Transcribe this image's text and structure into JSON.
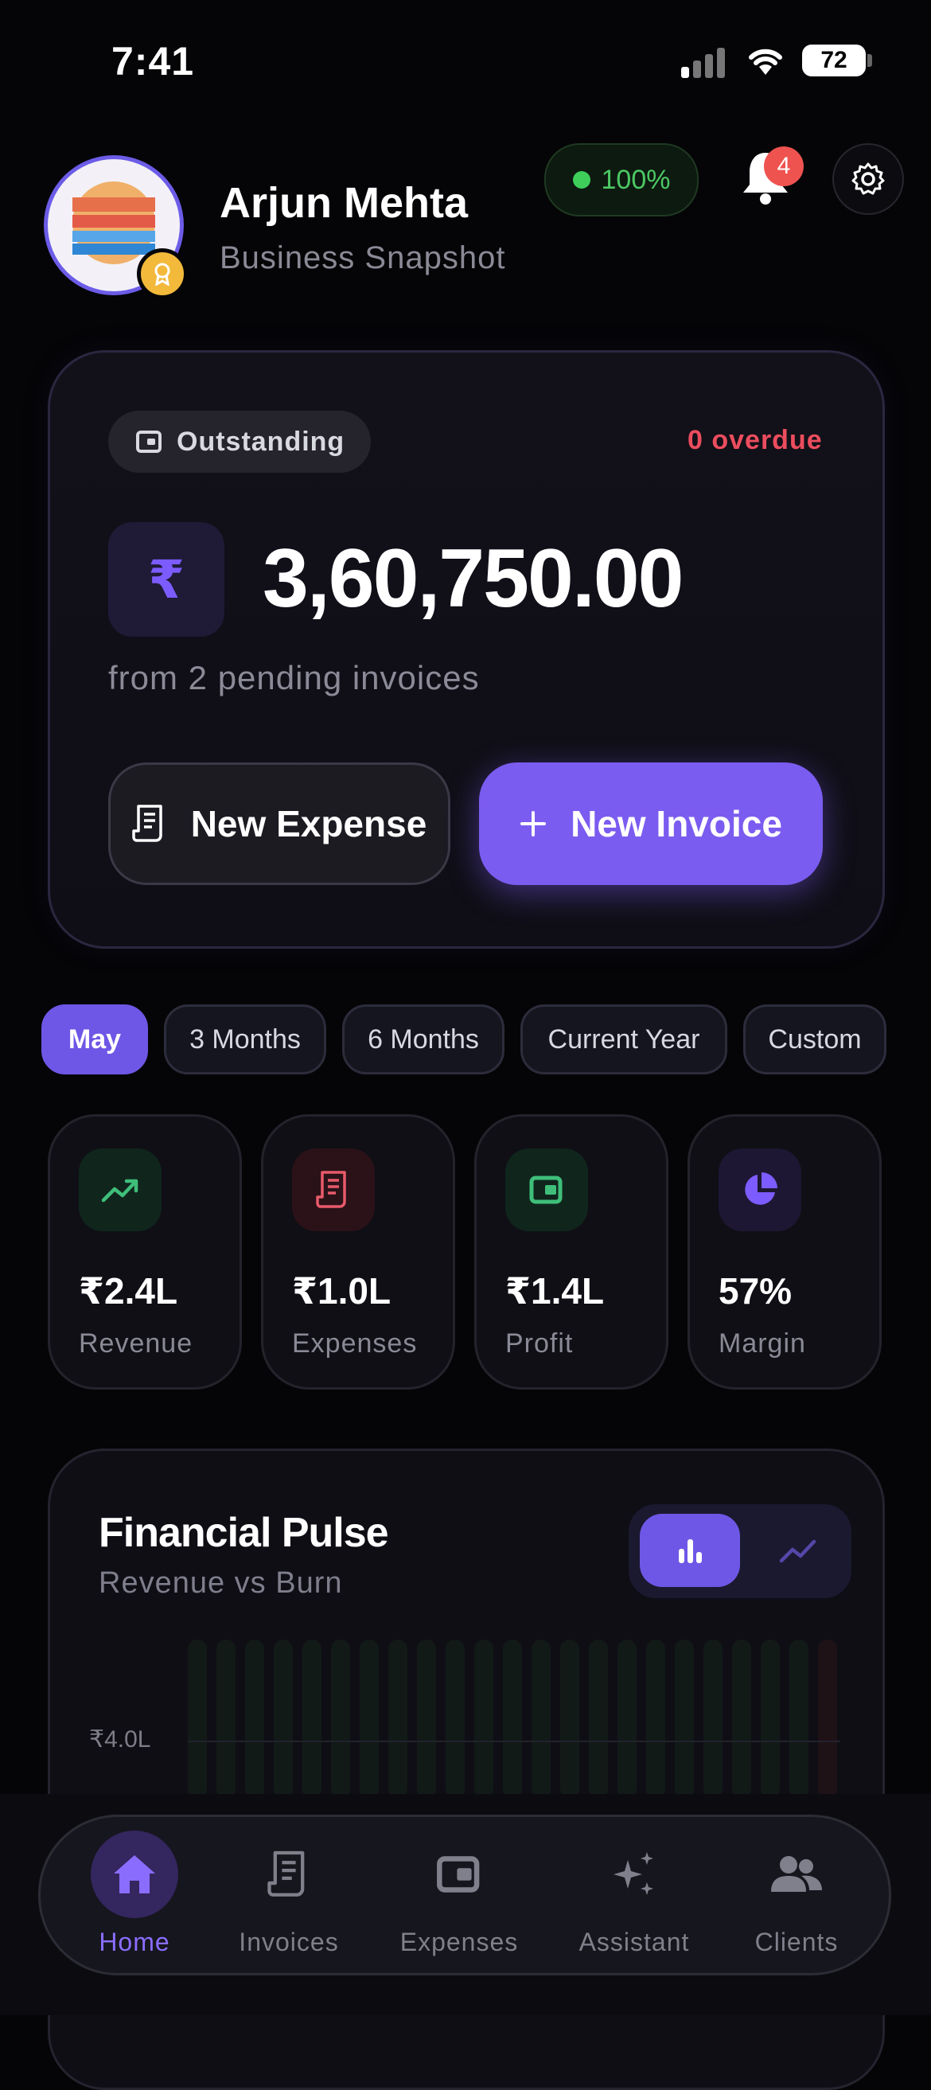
{
  "status_bar": {
    "time": "7:41",
    "battery": "72"
  },
  "header": {
    "name": "Arjun Mehta",
    "subtitle": "Business Snapshot",
    "health": "100%",
    "notifications_count": "4"
  },
  "outstanding": {
    "label": "Outstanding",
    "overdue": "0 overdue",
    "currency_symbol": "₹",
    "amount": "3,60,750.00",
    "pending_text": "from 2 pending invoices",
    "new_expense": "New Expense",
    "new_invoice": "New Invoice"
  },
  "periods": [
    {
      "label": "May",
      "active": true
    },
    {
      "label": "3 Months",
      "active": false
    },
    {
      "label": "6 Months",
      "active": false
    },
    {
      "label": "Current Year",
      "active": false
    },
    {
      "label": "Custom",
      "active": false
    }
  ],
  "stats": [
    {
      "value": "₹2.4L",
      "label": "Revenue",
      "icon": "trending-up-icon",
      "color": "#3fbf7a"
    },
    {
      "value": "₹1.0L",
      "label": "Expenses",
      "icon": "receipt-icon",
      "color": "#e85a6a"
    },
    {
      "value": "₹1.4L",
      "label": "Profit",
      "icon": "wallet-icon",
      "color": "#3fbf7a"
    },
    {
      "value": "57%",
      "label": "Margin",
      "icon": "pie-chart-icon",
      "color": "#7c5cff"
    }
  ],
  "pulse": {
    "title": "Financial Pulse",
    "subtitle": "Revenue vs Burn",
    "axis_label": "₹4.0L"
  },
  "nav": [
    {
      "label": "Home",
      "active": true
    },
    {
      "label": "Invoices",
      "active": false
    },
    {
      "label": "Expenses",
      "active": false
    },
    {
      "label": "Assistant",
      "active": false
    },
    {
      "label": "Clients",
      "active": false
    }
  ],
  "colors": {
    "accent": "#6e57e6",
    "danger": "#ec4d5e",
    "success": "#3fbf7a",
    "background": "#050507"
  }
}
